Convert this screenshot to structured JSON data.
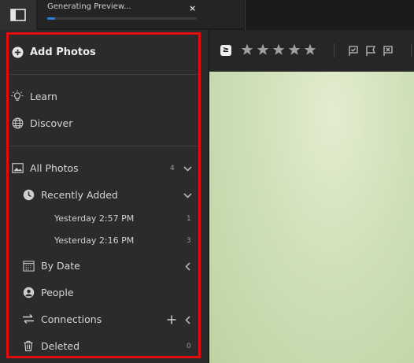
{
  "topbar": {
    "progress_label": "Generating Preview...",
    "close_glyph": "×",
    "progress_fraction": 0.05
  },
  "sidebar": {
    "add_photos": "Add Photos",
    "learn": "Learn",
    "discover": "Discover",
    "all_photos": {
      "label": "All Photos",
      "count": "4"
    },
    "recently_added": {
      "label": "Recently Added"
    },
    "recent_items": [
      {
        "label": "Yesterday 2:57 PM",
        "count": "1"
      },
      {
        "label": "Yesterday 2:16 PM",
        "count": "3"
      }
    ],
    "by_date": "By Date",
    "people": "People",
    "connections": "Connections",
    "deleted": {
      "label": "Deleted",
      "count": "0"
    }
  },
  "toolbar": {
    "filter_glyph": "≥",
    "star_count": 5
  },
  "colors": {
    "highlight": "#e30b0b",
    "progress": "#2b7fe0",
    "sidebar_bg": "#2b2b2b"
  }
}
